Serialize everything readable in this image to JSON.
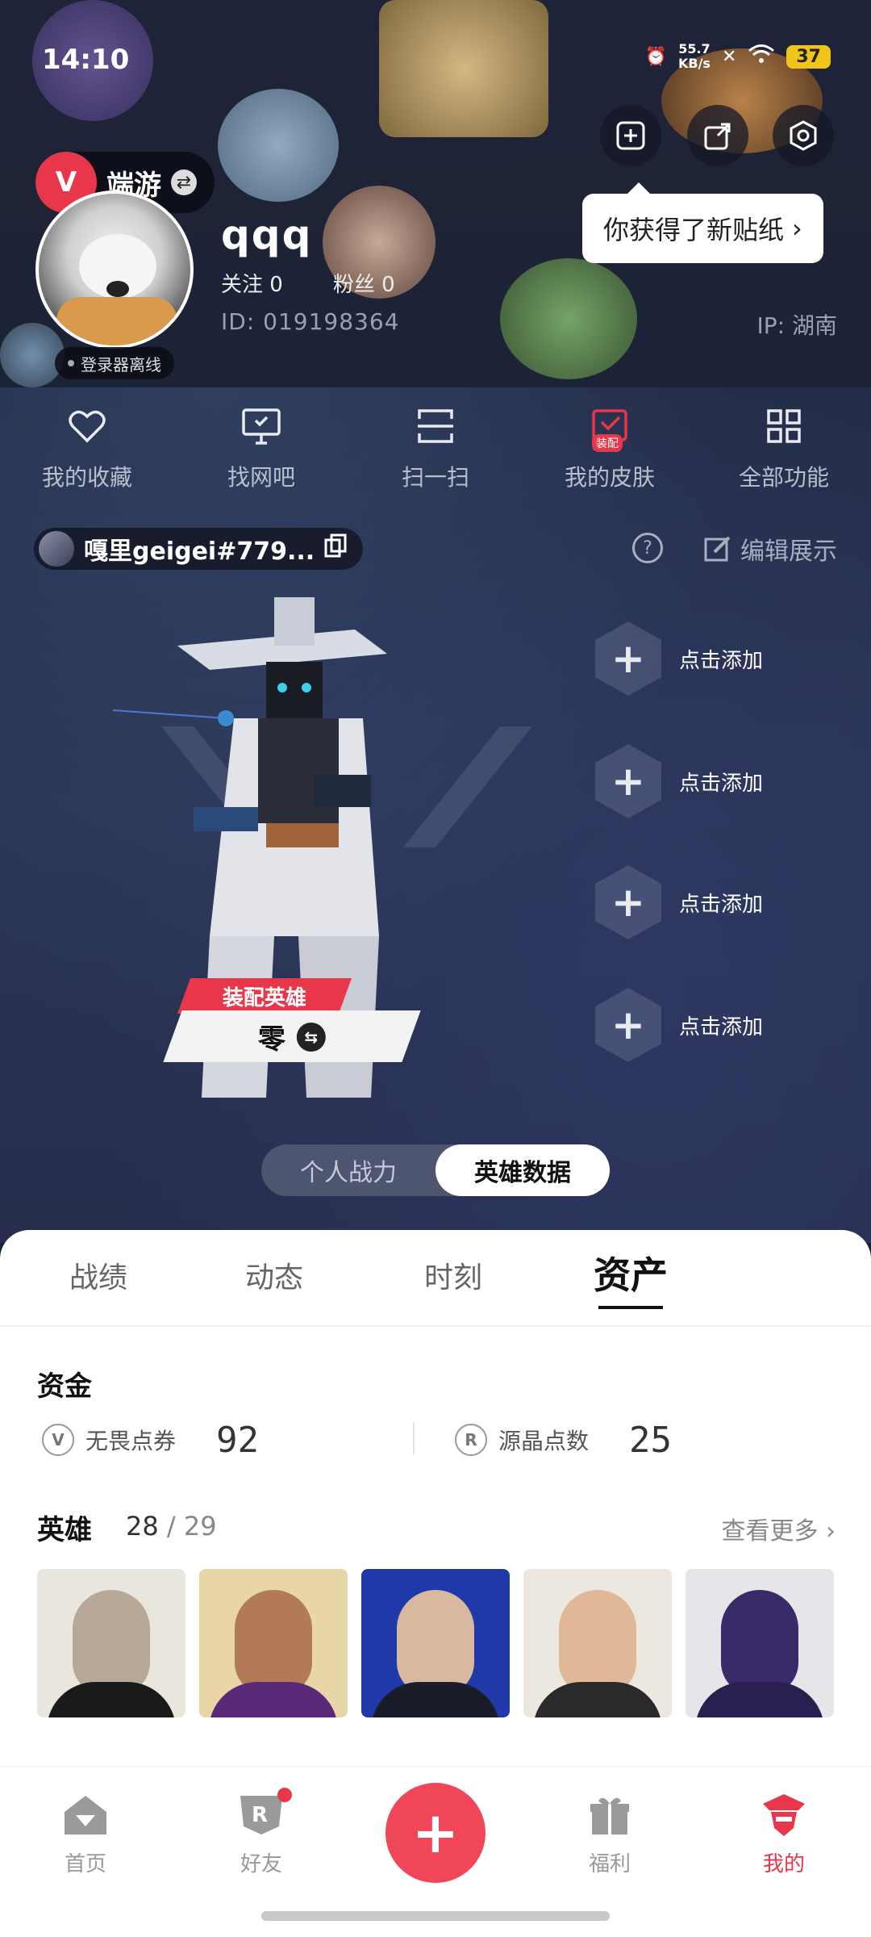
{
  "status_bar": {
    "time": "14:10",
    "net_speed_top": "55.7",
    "net_speed_bottom": "KB/s",
    "battery": "37"
  },
  "profile": {
    "game_name": "端游",
    "username": "qqq",
    "following_label": "关注",
    "following_count": "0",
    "followers_label": "粉丝",
    "followers_count": "0",
    "uid_label": "ID:",
    "uid": "019198364",
    "ip_label": "IP:",
    "ip_location": "湖南",
    "login_status": "登录器离线"
  },
  "tooltip": {
    "text": "你获得了新贴纸"
  },
  "quick_actions": [
    {
      "label": "我的收藏",
      "icon": "heart-icon"
    },
    {
      "label": "找网吧",
      "icon": "monitor-icon"
    },
    {
      "label": "扫一扫",
      "icon": "scan-icon"
    },
    {
      "label": "我的皮肤",
      "icon": "skin-icon",
      "badge": "装配"
    },
    {
      "label": "全部功能",
      "icon": "grid-icon"
    }
  ],
  "player_chip": {
    "riot_id": "嘎里geigei#779..."
  },
  "edit_display_label": "编辑展示",
  "equipped_agent": {
    "tag": "装配英雄",
    "name": "零"
  },
  "add_slots": [
    "点击添加",
    "点击添加",
    "点击添加",
    "点击添加"
  ],
  "view_toggle": {
    "options": [
      "个人战力",
      "英雄数据"
    ],
    "active_index": 1
  },
  "tabs": {
    "items": [
      "战绩",
      "动态",
      "时刻",
      "资产"
    ],
    "active_index": 3
  },
  "funds": {
    "title": "资金",
    "items": [
      {
        "label": "无畏点券",
        "value": "92",
        "icon": "valorant-points-icon"
      },
      {
        "label": "源晶点数",
        "value": "25",
        "icon": "radianite-icon"
      }
    ]
  },
  "heroes": {
    "title": "英雄",
    "owned": "28",
    "total": "29",
    "see_more": "查看更多",
    "cards": [
      {
        "name": "viper-portrait"
      },
      {
        "name": "iso-portrait"
      },
      {
        "name": "yoru-portrait"
      },
      {
        "name": "chamber-portrait"
      },
      {
        "name": "kayo-portrait"
      }
    ]
  },
  "bottom_nav": {
    "items": [
      {
        "label": "首页",
        "icon": "home-icon"
      },
      {
        "label": "好友",
        "icon": "friends-icon",
        "has_dot": true
      },
      {
        "label": "福利",
        "icon": "gift-icon"
      },
      {
        "label": "我的",
        "icon": "profile-icon",
        "active": true
      }
    ],
    "fab_icon": "plus-icon"
  },
  "colors": {
    "accent": "#e8364a",
    "fab": "#f04657",
    "header_bg": "#1d2336"
  }
}
